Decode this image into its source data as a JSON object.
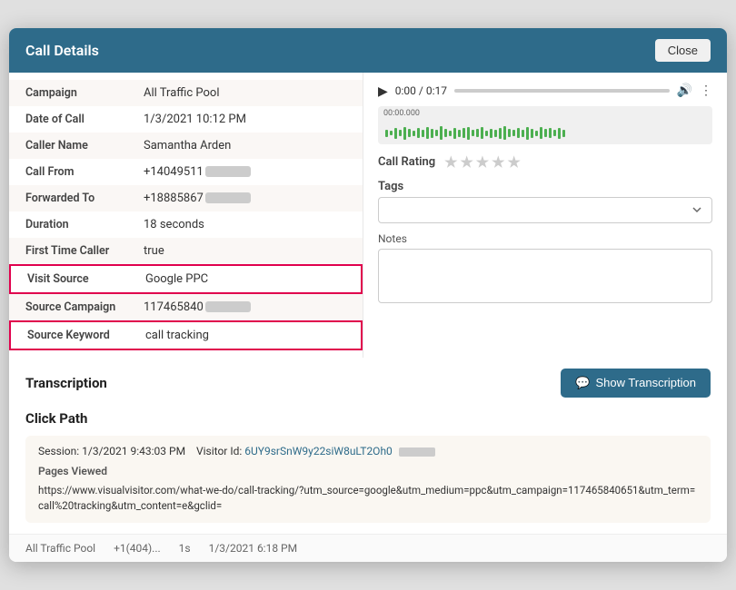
{
  "modal": {
    "title": "Call Details",
    "close_label": "Close"
  },
  "details": {
    "rows": [
      {
        "label": "Campaign",
        "value": "All Traffic Pool",
        "redacted": false,
        "highlighted": false
      },
      {
        "label": "Date of Call",
        "value": "1/3/2021 10:12 PM",
        "redacted": false,
        "highlighted": false
      },
      {
        "label": "Caller Name",
        "value": "Samantha Arden",
        "redacted": false,
        "highlighted": false
      },
      {
        "label": "Call From",
        "value": "+14049511",
        "redacted": true,
        "highlighted": false
      },
      {
        "label": "Forwarded To",
        "value": "+18885867",
        "redacted": true,
        "highlighted": false
      },
      {
        "label": "Duration",
        "value": "18 seconds",
        "redacted": false,
        "highlighted": false
      },
      {
        "label": "First Time Caller",
        "value": "true",
        "redacted": false,
        "highlighted": false
      },
      {
        "label": "Visit Source",
        "value": "Google PPC",
        "redacted": false,
        "highlighted": true
      },
      {
        "label": "Source Campaign",
        "value": "117465840",
        "redacted": true,
        "highlighted": false
      },
      {
        "label": "Source Keyword",
        "value": "call tracking",
        "redacted": false,
        "highlighted": true
      }
    ]
  },
  "audio": {
    "current_time": "0:00",
    "total_time": "0:17",
    "time_display": "0:00 / 0:17"
  },
  "waveform": {
    "time_label": "00:00.000",
    "bars": [
      8,
      5,
      12,
      7,
      14,
      9,
      6,
      11,
      8,
      13,
      10,
      7,
      15,
      9,
      6,
      12,
      8,
      11,
      14,
      7,
      9,
      13,
      6,
      10,
      8,
      12,
      15,
      9,
      7,
      11,
      8,
      14,
      10,
      6,
      13,
      9,
      11,
      7,
      12,
      8
    ]
  },
  "call_rating": {
    "label": "Call Rating",
    "stars": [
      false,
      false,
      false,
      false,
      false
    ]
  },
  "tags": {
    "label": "Tags",
    "placeholder": "",
    "options": []
  },
  "notes": {
    "label": "Notes",
    "placeholder": ""
  },
  "transcription": {
    "section_title": "Transcription",
    "button_label": "Show Transcription",
    "button_icon": "chat-icon"
  },
  "click_path": {
    "section_title": "Click Path",
    "session": {
      "label": "Session:",
      "date": "1/3/2021 9:43:03 PM",
      "visitor_label": "Visitor Id:",
      "visitor_id": "6UY9srSnW9y22siW8uLT2Oh0"
    },
    "pages_viewed_label": "Pages Viewed",
    "url": "https://www.visualvisitor.com/what-we-do/call-tracking/?utm_source=google&utm_medium=ppc&utm_campaign=117465840651&utm_term=call%20tracking&utm_content=e&gclid="
  },
  "bottom_row": {
    "col1": "All Traffic Pool",
    "col2": "+1(404)...",
    "col3": "1s",
    "col4": "1/3/2021 6:18 PM"
  }
}
